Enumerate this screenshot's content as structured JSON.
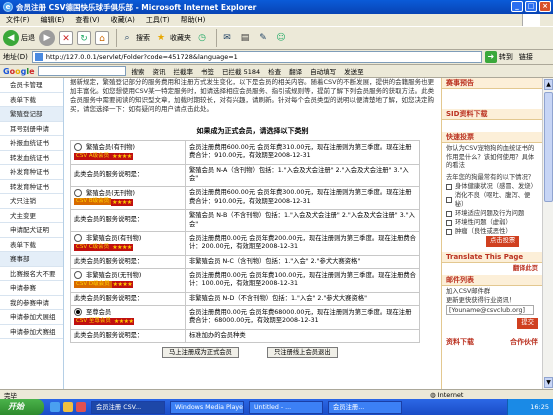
{
  "window": {
    "title": "会员注册  CSV德国快乐球手俱乐部 - Microsoft Internet Explorer",
    "controls": [
      "_",
      "□",
      "×"
    ]
  },
  "menu": [
    "文件(F)",
    "编辑(E)",
    "查看(V)",
    "收藏(A)",
    "工具(T)",
    "帮助(H)"
  ],
  "toolbar": {
    "back": "后退",
    "search": "搜索",
    "favorites": "收藏夹"
  },
  "address": {
    "label": "地址(D)",
    "url": "http://127.0.0.1/servlet/Folder?code=451728&language=1",
    "go": "转到",
    "links": "链接"
  },
  "googlebar": {
    "search_button": "搜索",
    "news": "资讯",
    "block": "拦截率",
    "bookmarks": "书签",
    "blocked": "已拦截 5184",
    "check": "检查",
    "translate": "翻译",
    "autofill": "自动填写",
    "send_to": "发送至"
  },
  "leftnav": [
    "会员卡管理",
    "表单下载",
    "繁殖登记部",
    "耳号别册申请",
    "补报血统证书",
    "转发血统证书",
    "补发育种证书",
    "转发育种证书",
    "犬只注销",
    "犬主变更",
    "申请配犬证明",
    "表单下载",
    "赛事部",
    "比赛报名大不要",
    "申请参赛",
    "我的参赛申请",
    "申请参加犬展组",
    "申请参加犬赛组"
  ],
  "main": {
    "intro": "据新规定，繁殖登记部分的服务费用和注册方式发生变化，以下是会员的相关内容。随着CSV的不断发展，提供的会籍服务也更加丰富化。如您想使用CSV某一特定服务时，如请选择相应会员服务、指引或规则等，提前了解下列会员服务的获取方法。此类会员服务中需要阅读的知识型文章，加载时期较长，对有兴趣，请刷新。针对每个会员类型的说明以便清楚地了解，如您决定购买，请您选择一下：如有疑问的用户请点击此处。",
    "table_title": "如果成为正式会员，请选择以下类别",
    "plans": [
      {
        "name": "繁殖会员(有刊物)",
        "badge": "CSV A级会员",
        "stars": "★★★★",
        "desc": "会员注册费用600.00元 会员年费310.00元，现在注册则为第三季度。现在注册费合计：910.00元，有效期至2008-12-31",
        "selected": false
      },
      {
        "name": "",
        "badge": "",
        "stars": "",
        "desc": "繁殖会员 N-A（含刊物）包括：1.\"入会及犬会注册\" 2.\"入会及犬会注册\" 3.\"入会\"",
        "label": "此类会员的服务说明是：",
        "selected": false
      },
      {
        "name": "繁殖会员(无刊物)",
        "badge": "CSV B级会员",
        "stars": "★★★★",
        "desc": "会员注册费用600.00元 会员年费300.00元，现在注册则为第三季度。现在注册费合计：910.00元，有效期至2008-12-31",
        "selected": false
      },
      {
        "name": "",
        "badge": "",
        "stars": "",
        "desc": "繁殖会员 N-B（不含刊物）包括：1.\"入会及犬会注册\" 2.\"入会及犬会注册\" 3.\"入会\"",
        "label": "此类会员的服务说明是：",
        "selected": false
      },
      {
        "name": "非繁殖会员(有刊物)",
        "badge": "CSV C级会员",
        "stars": "★★★★",
        "desc": "会员注册费用0.00元 会员年费200.00元，现在注册则为第三季度。现在注册费合计：200.00元，有效期至2008-12-31",
        "selected": false
      },
      {
        "name": "",
        "badge": "",
        "stars": "",
        "desc": "非繁殖会员 N-C（含刊物）包括：1.\"入会\" 2.\"参犬大赛资格\"",
        "label": "此类会员的服务说明是：",
        "selected": false
      },
      {
        "name": "非繁殖会员(无刊物)",
        "badge": "CSV D级会员",
        "stars": "★★★★",
        "desc": "会员注册费用0.00元 会员年费100.00元，现在注册则为第三季度。现在注册费合计：100.00元，有效期至2008-12-31",
        "selected": false
      },
      {
        "name": "",
        "badge": "",
        "stars": "",
        "desc": "非繁殖会员 N-D（不含刊物）包括：1.\"入会\" 2.\"参犬大赛资格\"",
        "label": "此类会员的服务说明是：",
        "selected": false
      },
      {
        "name": "至尊会员",
        "badge": "CSV 至尊会员",
        "stars": "★★★★",
        "desc": "会员注册费用0.00元 会员年费68000.00元，现在注册则为第三季度。现在注册费合计：68000.00元，有效期至2008-12-31",
        "selected": true
      },
      {
        "name": "",
        "badge": "",
        "stars": "",
        "desc": "标准加办的会员种类",
        "label": "此类会员的服务说明是：",
        "selected": false
      }
    ],
    "buttons": {
      "upgrade": "马上注册成为正式会员",
      "basic": "只注册线上会员退出"
    }
  },
  "right": {
    "notice_title": "赛事预告",
    "sid_title": "SID资料下载",
    "quick_title": "快速投票",
    "quick_text": "你认为CSV宠物狗的血统证书的作用是什么？该如何使用？具体的看法",
    "quick_question": "去年您的狗最常有的以下情况？",
    "options": [
      "身体健康状况（感冒、发烧）",
      "消化不良（呕吐、腹泻、便秘）",
      "环境适应问题及行为问题",
      "环境性问题（虚弱）",
      "肿瘤（良性或恶性）"
    ],
    "vote_btn": "点击投票",
    "translate_title": "Translate This Page",
    "translate_link": "翻译此页",
    "email_title": "邮件列表",
    "email_desc": "加入CSV邮件群",
    "email_desc2": "更新更快获得行业资讯！",
    "email_placeholder": "[Youname@csvclub.org]",
    "submit": "提交",
    "download": "资料下载",
    "partner": "合作伙伴"
  },
  "status": {
    "done": "完毕",
    "zone": "Internet"
  },
  "taskbar": {
    "start": "开始",
    "tasks": [
      "会员注册 CSV...",
      "Windows Media Player",
      "Untitled - ...",
      "会员注册..."
    ],
    "time": "16:25"
  }
}
